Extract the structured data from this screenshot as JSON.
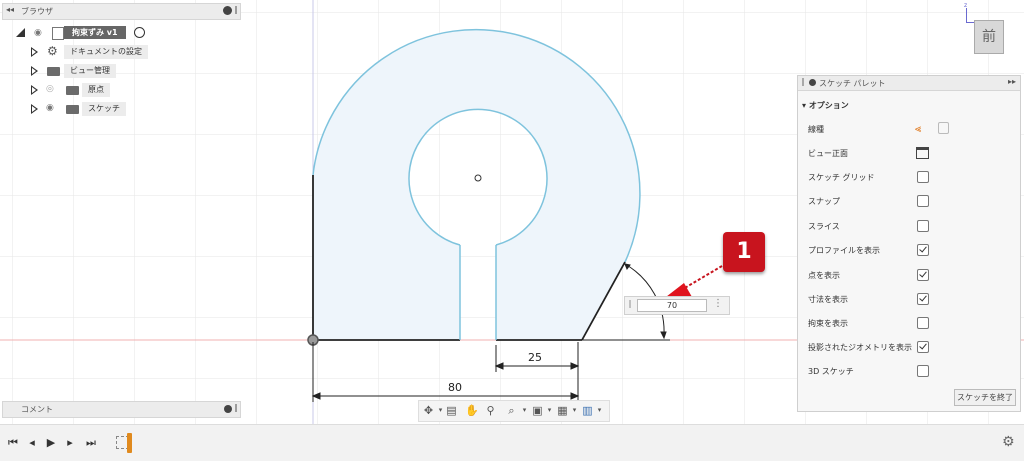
{
  "browser": {
    "title": "ブラウザ",
    "root_name": "拘束ずみ v1",
    "items": [
      {
        "label": "ドキュメントの設定"
      },
      {
        "label": "ビュー管理"
      },
      {
        "label": "原点"
      },
      {
        "label": "スケッチ"
      }
    ]
  },
  "comments": {
    "title": "コメント"
  },
  "viewcube": {
    "label": "前"
  },
  "dimensions": {
    "horizontal_total": "80",
    "slot_width": "25",
    "angle_input": "70"
  },
  "callout": {
    "number": "1"
  },
  "palette": {
    "title": "スケッチ パレット",
    "section": "オプション",
    "rows": [
      {
        "label": "線種",
        "type": "icons"
      },
      {
        "label": "ビュー正面",
        "type": "icon"
      },
      {
        "label": "スケッチ グリッド",
        "checked": false
      },
      {
        "label": "スナップ",
        "checked": false
      },
      {
        "label": "スライス",
        "checked": false
      },
      {
        "label": "プロファイルを表示",
        "checked": true
      },
      {
        "label": "点を表示",
        "checked": true
      },
      {
        "label": "寸法を表示",
        "checked": true
      },
      {
        "label": "拘束を表示",
        "checked": false
      },
      {
        "label": "投影されたジオメトリを表示",
        "checked": true
      },
      {
        "label": "3D スケッチ",
        "checked": false
      }
    ],
    "finish_button": "スケッチを終了"
  },
  "colors": {
    "profile_fill": "#eef5fb",
    "profile_stroke": "#7ec3dd",
    "badge": "#c8141e"
  }
}
